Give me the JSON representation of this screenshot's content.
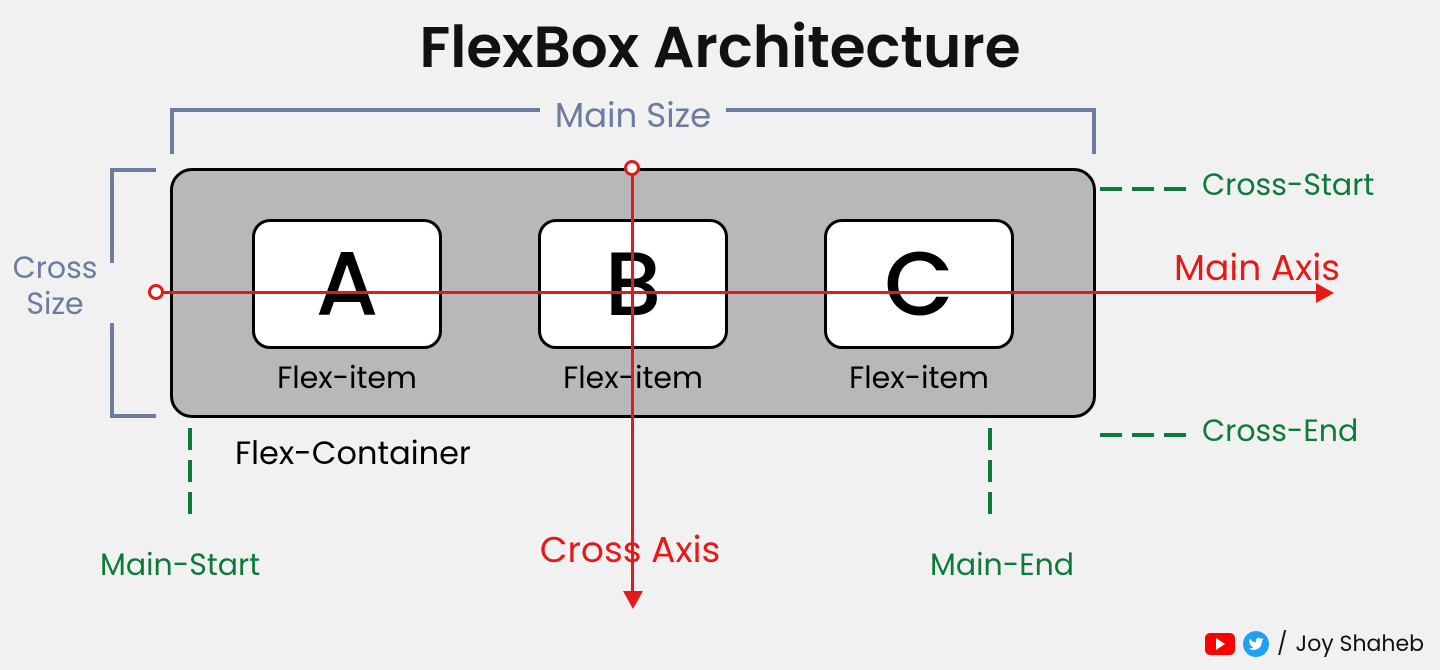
{
  "title": "FlexBox Architecture",
  "labels": {
    "main_size": "Main Size",
    "cross_size_line1": "Cross",
    "cross_size_line2": "Size",
    "main_axis": "Main Axis",
    "cross_axis": "Cross Axis",
    "cross_start": "Cross-Start",
    "cross_end": "Cross-End",
    "main_start": "Main-Start",
    "main_end": "Main-End",
    "flex_container": "Flex-Container"
  },
  "items": [
    {
      "letter": "A",
      "caption": "Flex-item"
    },
    {
      "letter": "B",
      "caption": "Flex-item"
    },
    {
      "letter": "C",
      "caption": "Flex-item"
    }
  ],
  "credits": {
    "separator": "/",
    "author": "Joy Shaheb"
  }
}
